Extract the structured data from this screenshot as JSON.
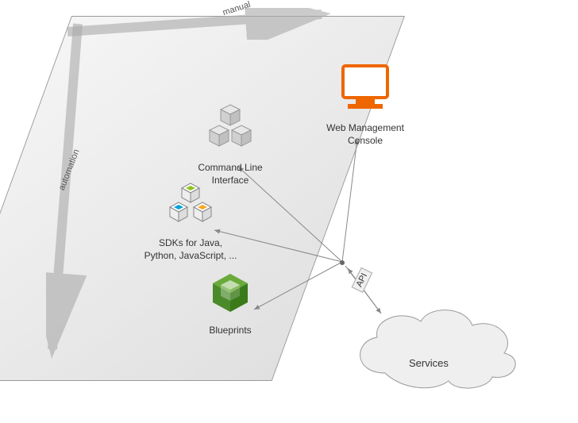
{
  "axes": {
    "manual": "manual",
    "automation": "automation"
  },
  "components": {
    "web_console": "Web Management\nConsole",
    "cli": "Command Line\nInterface",
    "sdks": "SDKs for Java,\nPython, JavaScript, ...",
    "blueprints": "Blueprints"
  },
  "api_label": "API",
  "services_label": "Services"
}
